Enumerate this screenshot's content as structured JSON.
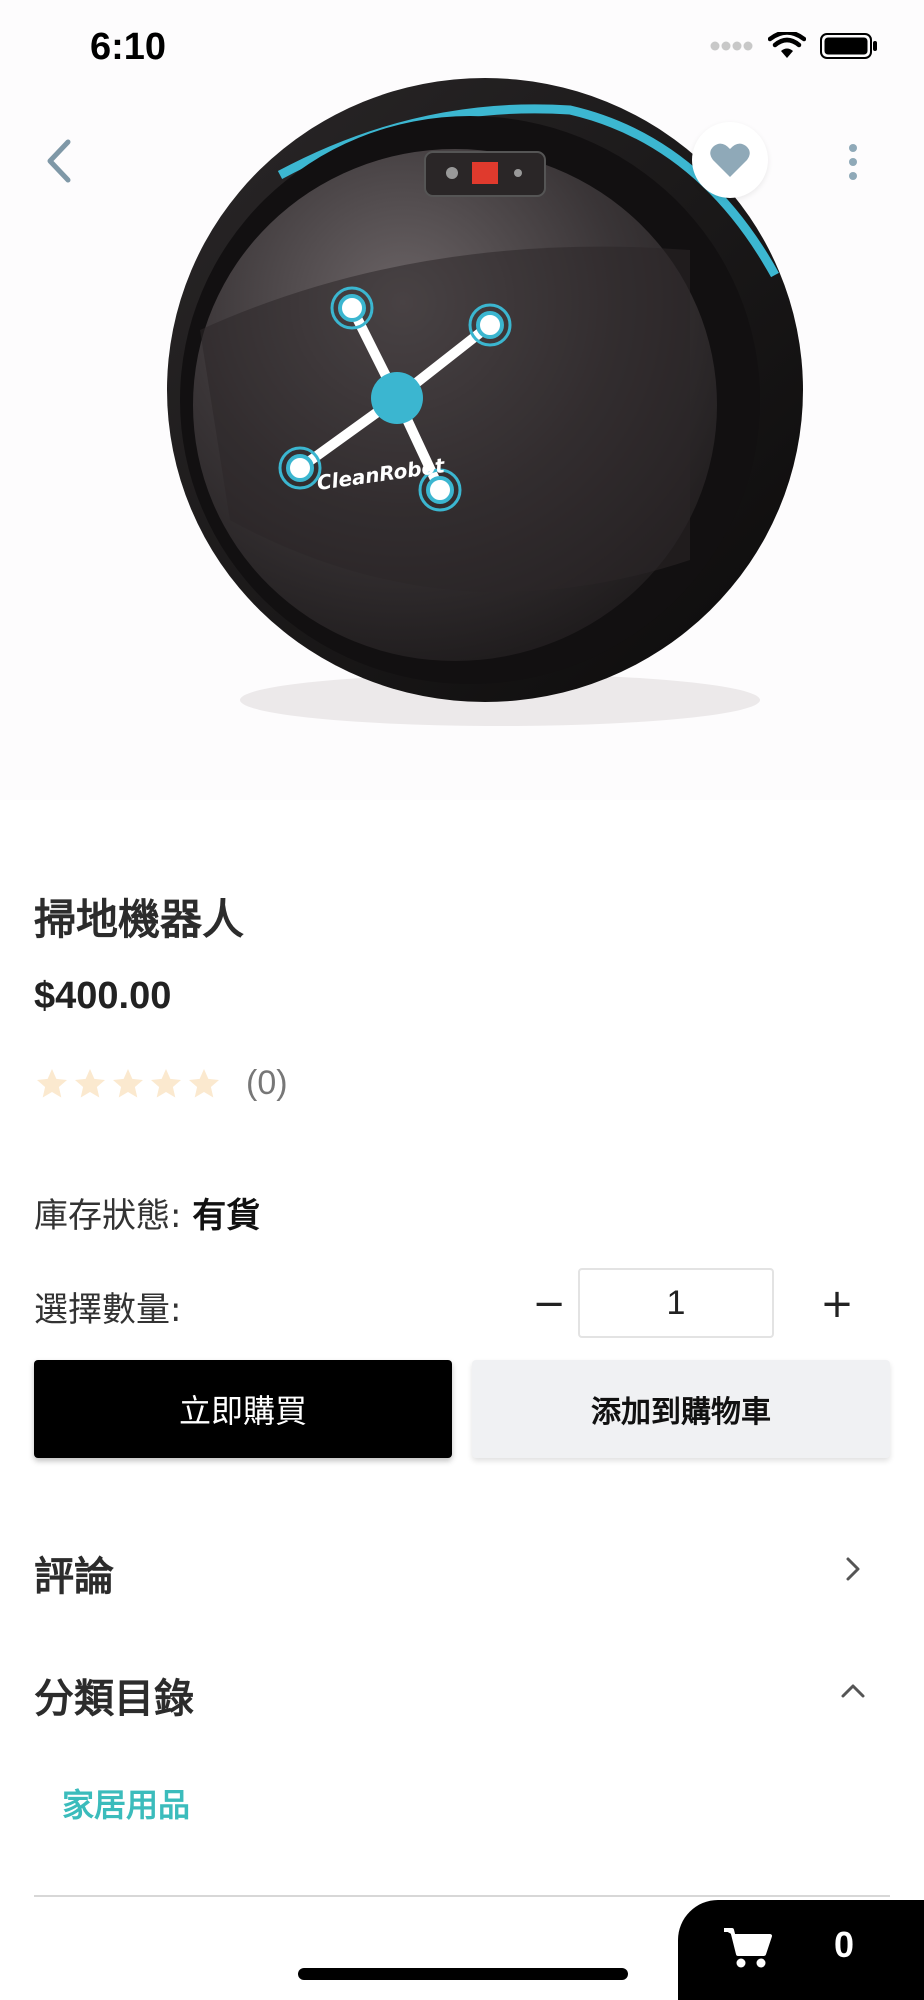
{
  "status_bar": {
    "time": "6:10"
  },
  "product": {
    "title": "掃地機器人",
    "price": "$400.00",
    "rating": 0,
    "review_count": "(0)",
    "image_brand_text": "CleanRobot",
    "stock_label": "庫存狀態:",
    "stock_value": "有貨",
    "quantity_label": "選擇數量:",
    "quantity_value": "1",
    "favorited": true
  },
  "actions": {
    "buy_now": "立即購買",
    "add_to_cart": "添加到購物車",
    "minus": "−",
    "plus": "+"
  },
  "sections": {
    "reviews": "評論",
    "categories": "分類目錄",
    "category_items": [
      "家居用品"
    ]
  },
  "cart": {
    "count": "0"
  },
  "colors": {
    "accent_teal": "#3bbcbc",
    "star_empty": "#fbe9cf",
    "primary_button": "#000000",
    "secondary_button": "#f0f1f3"
  }
}
